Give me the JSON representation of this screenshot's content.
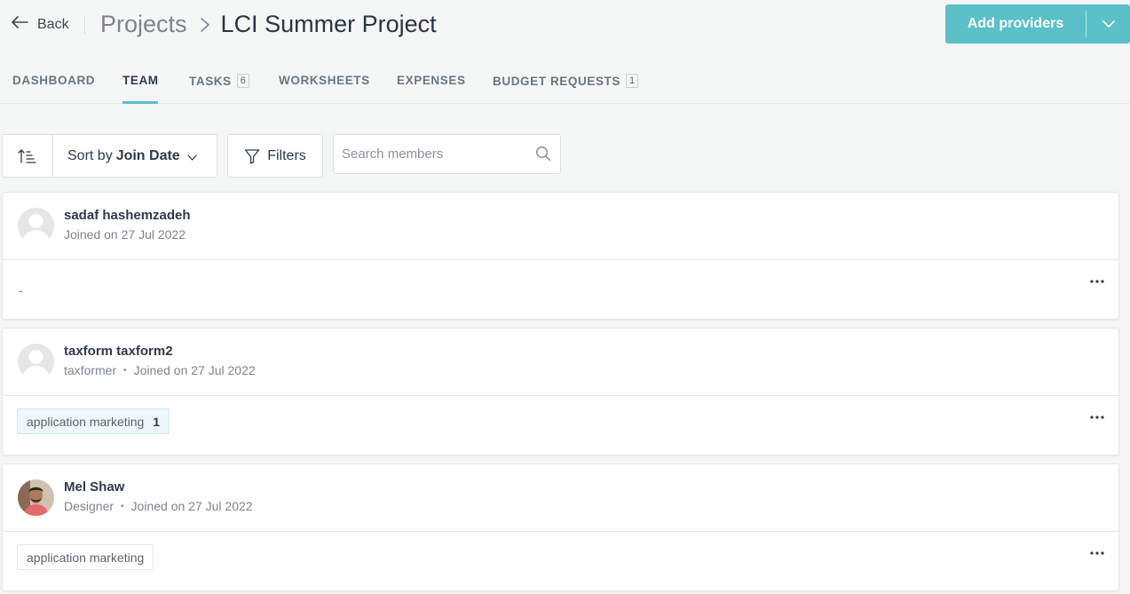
{
  "header": {
    "back_label": "Back",
    "breadcrumb_parent": "Projects",
    "project_title": "LCI Summer Project",
    "add_button_label": "Add providers"
  },
  "tabs": [
    {
      "label": "DASHBOARD",
      "count": ""
    },
    {
      "label": "TEAM",
      "count": "",
      "active": true
    },
    {
      "label": "TASKS",
      "count": "6"
    },
    {
      "label": "WORKSHEETS",
      "count": ""
    },
    {
      "label": "EXPENSES",
      "count": ""
    },
    {
      "label": "BUDGET REQUESTS",
      "count": "1"
    }
  ],
  "toolbar": {
    "sort_prefix": "Sort by",
    "sort_value": "Join Date",
    "filters_label": "Filters",
    "search_placeholder": "Search members"
  },
  "members": [
    {
      "name": "sadaf hashemzadeh",
      "role": "",
      "joined": "Joined on 27 Jul 2022",
      "tags_text": "-",
      "avatar": "placeholder-avatar-icon"
    },
    {
      "name": "taxform taxform2",
      "role": "taxformer",
      "joined": "Joined on 27 Jul 2022",
      "tag": {
        "label": "application marketing",
        "count": "1"
      },
      "avatar": "placeholder-avatar-icon"
    },
    {
      "name": "Mel Shaw",
      "role": "Designer",
      "joined": "Joined on 27 Jul 2022",
      "tag": {
        "label": "application marketing",
        "count": ""
      },
      "avatar": "photo-avatar"
    }
  ],
  "colors": {
    "accent": "#5bc0c8",
    "background": "#f5f6f6",
    "text": "#2f3a4b",
    "muted": "#7b8491"
  }
}
